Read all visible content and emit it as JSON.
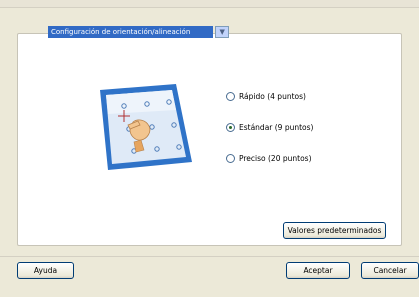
{
  "orientation_selector": {
    "selected_value": "Configuración de orientación/alineación"
  },
  "calibration_modes": {
    "options": [
      {
        "label": "Rápido (4 puntos)",
        "selected": false
      },
      {
        "label": "Estándar (9 puntos)",
        "selected": true
      },
      {
        "label": "Preciso (20 puntos)",
        "selected": false
      }
    ]
  },
  "buttons": {
    "defaults_label": "Valores predeterminados",
    "help_label": "Ayuda",
    "accept_label": "Aceptar",
    "cancel_label": "Cancelar"
  },
  "colors": {
    "selection_blue": "#316ac5",
    "screen_frame": "#2f73c8",
    "radio_dot": "#2b6a2b"
  },
  "icons": {
    "dropdown": "chevron-down-icon",
    "illustration": "touchscreen-calibration-illustration"
  }
}
